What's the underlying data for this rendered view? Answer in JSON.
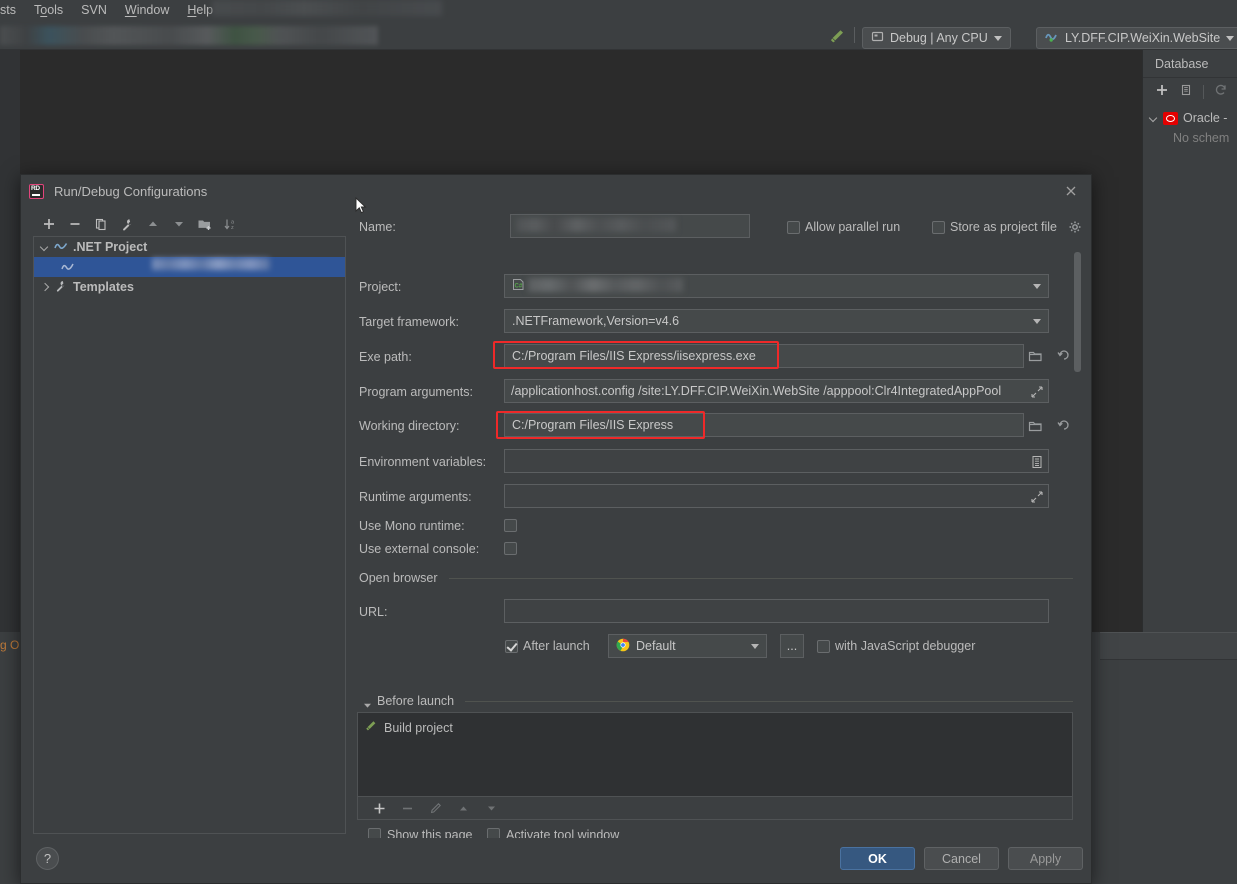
{
  "ide": {
    "menubar": {
      "items": [
        {
          "label": "sts",
          "clipped": true
        },
        {
          "label": "Tools",
          "mnemonic": "o"
        },
        {
          "label": "SVN",
          "mnemonic": ""
        },
        {
          "label": "Window",
          "mnemonic": "W"
        },
        {
          "label": "Help",
          "mnemonic": "H"
        }
      ]
    },
    "toolbar": {
      "build_icon": "hammer-icon",
      "configuration_label": "Debug | Any CPU",
      "configuration_icon": "run-config-icon",
      "project_label": "LY.DFF.CIP.WeiXin.WebSite",
      "project_icon": "dotnet-project-icon"
    },
    "database_panel": {
      "title": "Database",
      "toolbar_icons": [
        "add-icon",
        "copy-icon",
        "refresh-icon"
      ],
      "tree": [
        {
          "label": "Oracle -",
          "icon": "oracle-icon",
          "expanded": true
        },
        {
          "label": "No schem",
          "sub": true
        }
      ]
    },
    "bottom_tab_clipped": "g Ou"
  },
  "dialog": {
    "title": "Run/Debug Configurations",
    "icon": "rider-icon",
    "close_icon": "close-icon",
    "toolbar_icons": [
      "add-icon",
      "remove-icon",
      "copy-icon",
      "edit-templates-icon",
      "move-up-icon",
      "move-down-icon",
      "new-folder-icon",
      "sort-alphabetically-icon"
    ],
    "tree": {
      "items": [
        {
          "label": ".NET Project",
          "icon": "dotnet-icon",
          "expanded": true,
          "bold": true,
          "selected": false
        },
        {
          "label": "",
          "icon": "dotnet-icon",
          "child": true,
          "selected": true,
          "redacted": true
        },
        {
          "label": "Templates",
          "icon": "wrench-icon",
          "expanded": false,
          "bold": true,
          "selected": false
        }
      ]
    },
    "form": {
      "name_label": "Name:",
      "name_value": "",
      "name_redacted": true,
      "allow_parallel_run_label": "Allow parallel run",
      "allow_parallel_run_checked": false,
      "store_as_project_file_label": "Store as project file",
      "store_as_project_file_checked": false,
      "store_gear_icon": "gear-icon",
      "project_label": "Project:",
      "project_value": "",
      "project_redacted": true,
      "project_icon": "csharp-project-icon",
      "target_framework_label": "Target framework:",
      "target_framework_value": ".NETFramework,Version=v4.6",
      "exe_path_label": "Exe path:",
      "exe_path_value": "C:/Program Files/IIS Express/iisexpress.exe",
      "exe_path_highlighted": true,
      "exe_browse_icon": "folder-icon",
      "exe_reset_icon": "revert-icon",
      "program_arguments_label": "Program arguments:",
      "program_arguments_value": "/applicationhost.config /site:LY.DFF.CIP.WeiXin.WebSite /apppool:Clr4IntegratedAppPool",
      "program_arguments_expand_icon": "expand-icon",
      "working_directory_label": "Working directory:",
      "working_directory_value": "C:/Program Files/IIS Express",
      "working_directory_highlighted": true,
      "wd_browse_icon": "folder-icon",
      "wd_reset_icon": "revert-icon",
      "environment_variables_label": "Environment variables:",
      "environment_variables_value": "",
      "environment_variables_icon": "list-editor-icon",
      "runtime_arguments_label": "Runtime arguments:",
      "runtime_arguments_value": "",
      "runtime_arguments_expand_icon": "expand-icon",
      "use_mono_runtime_label": "Use Mono runtime:",
      "use_mono_runtime_checked": false,
      "use_external_console_label": "Use external console:",
      "use_external_console_checked": false,
      "open_browser_section": "Open browser",
      "url_label": "URL:",
      "url_value": "",
      "after_launch_label": "After launch",
      "after_launch_checked": true,
      "browser_value": "Default",
      "browser_icon": "chrome-icon",
      "browser_more_label": "...",
      "with_js_debugger_label": "with JavaScript debugger",
      "with_js_debugger_checked": false,
      "before_launch_section": "Before launch",
      "before_launch_items": [
        {
          "label": "Build project",
          "icon": "hammer-icon"
        }
      ],
      "before_launch_toolbar_icons": [
        "add-icon",
        "remove-icon",
        "edit-icon",
        "move-up-icon",
        "move-down-icon"
      ],
      "clipped_checkbox_1_label": "Show this page",
      "clipped_checkbox_1_checked": false,
      "clipped_checkbox_2_label": "Activate tool window",
      "clipped_checkbox_2_checked": true
    },
    "footer": {
      "help_label": "?",
      "ok_label": "OK",
      "cancel_label": "Cancel",
      "apply_label": "Apply"
    }
  },
  "colors": {
    "accent_blue": "#365880",
    "highlight_red": "#ef2929",
    "selection_blue": "#2f5597",
    "panel_bg": "#3c3f41",
    "editor_bg": "#2b2b2b"
  }
}
